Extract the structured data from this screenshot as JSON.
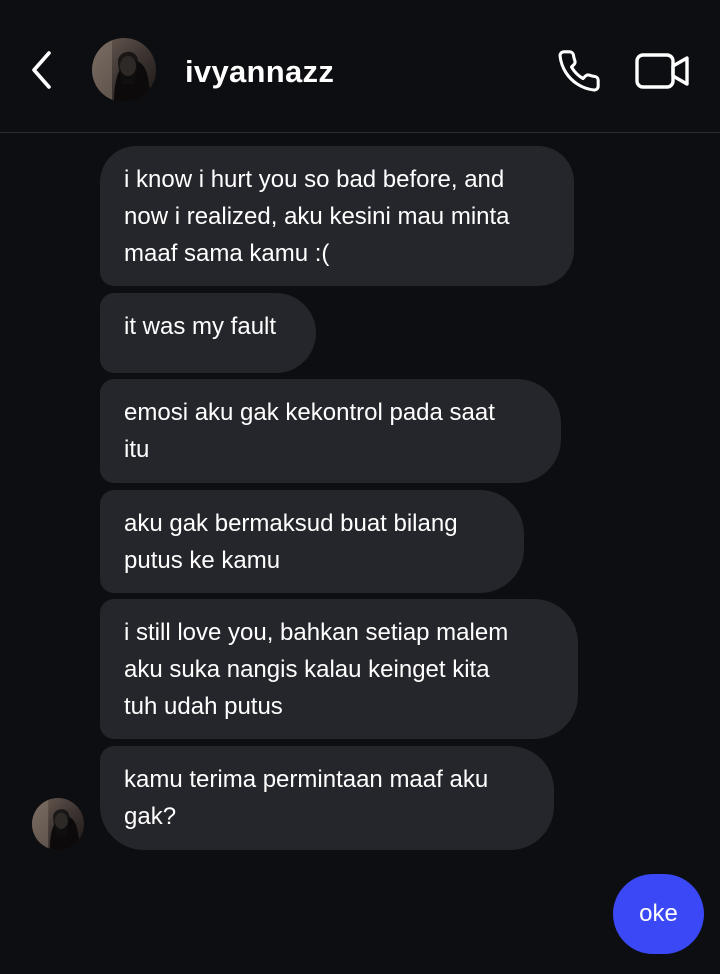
{
  "header": {
    "username": "ivyannazz",
    "back_icon": "chevron-left-icon",
    "call_icon": "phone-icon",
    "video_icon": "video-camera-icon"
  },
  "messages": [
    {
      "sender": "ivyannazz",
      "lines": [
        "i know i hurt you so bad before, and",
        "now i realized, aku kesini mau minta",
        "maaf sama kamu :("
      ]
    },
    {
      "sender": "ivyannazz",
      "lines": [
        "it was my fault"
      ]
    },
    {
      "sender": "ivyannazz",
      "lines": [
        "emosi aku gak kekontrol pada saat",
        "itu"
      ]
    },
    {
      "sender": "ivyannazz",
      "lines": [
        "aku gak bermaksud buat bilang",
        "putus ke kamu"
      ]
    },
    {
      "sender": "ivyannazz",
      "lines": [
        "i still love you, bahkan setiap malem",
        "aku suka nangis kalau keinget kita",
        "tuh udah putus"
      ]
    },
    {
      "sender": "ivyannazz",
      "lines": [
        "kamu terima permintaan maaf aku",
        "gak?"
      ]
    },
    {
      "sender": "me",
      "lines": [
        "oke"
      ]
    }
  ],
  "colors": {
    "background": "#0d0e12",
    "received_bubble": "#25262b",
    "sent_bubble": "#3a48f5",
    "text": "#ffffff"
  }
}
